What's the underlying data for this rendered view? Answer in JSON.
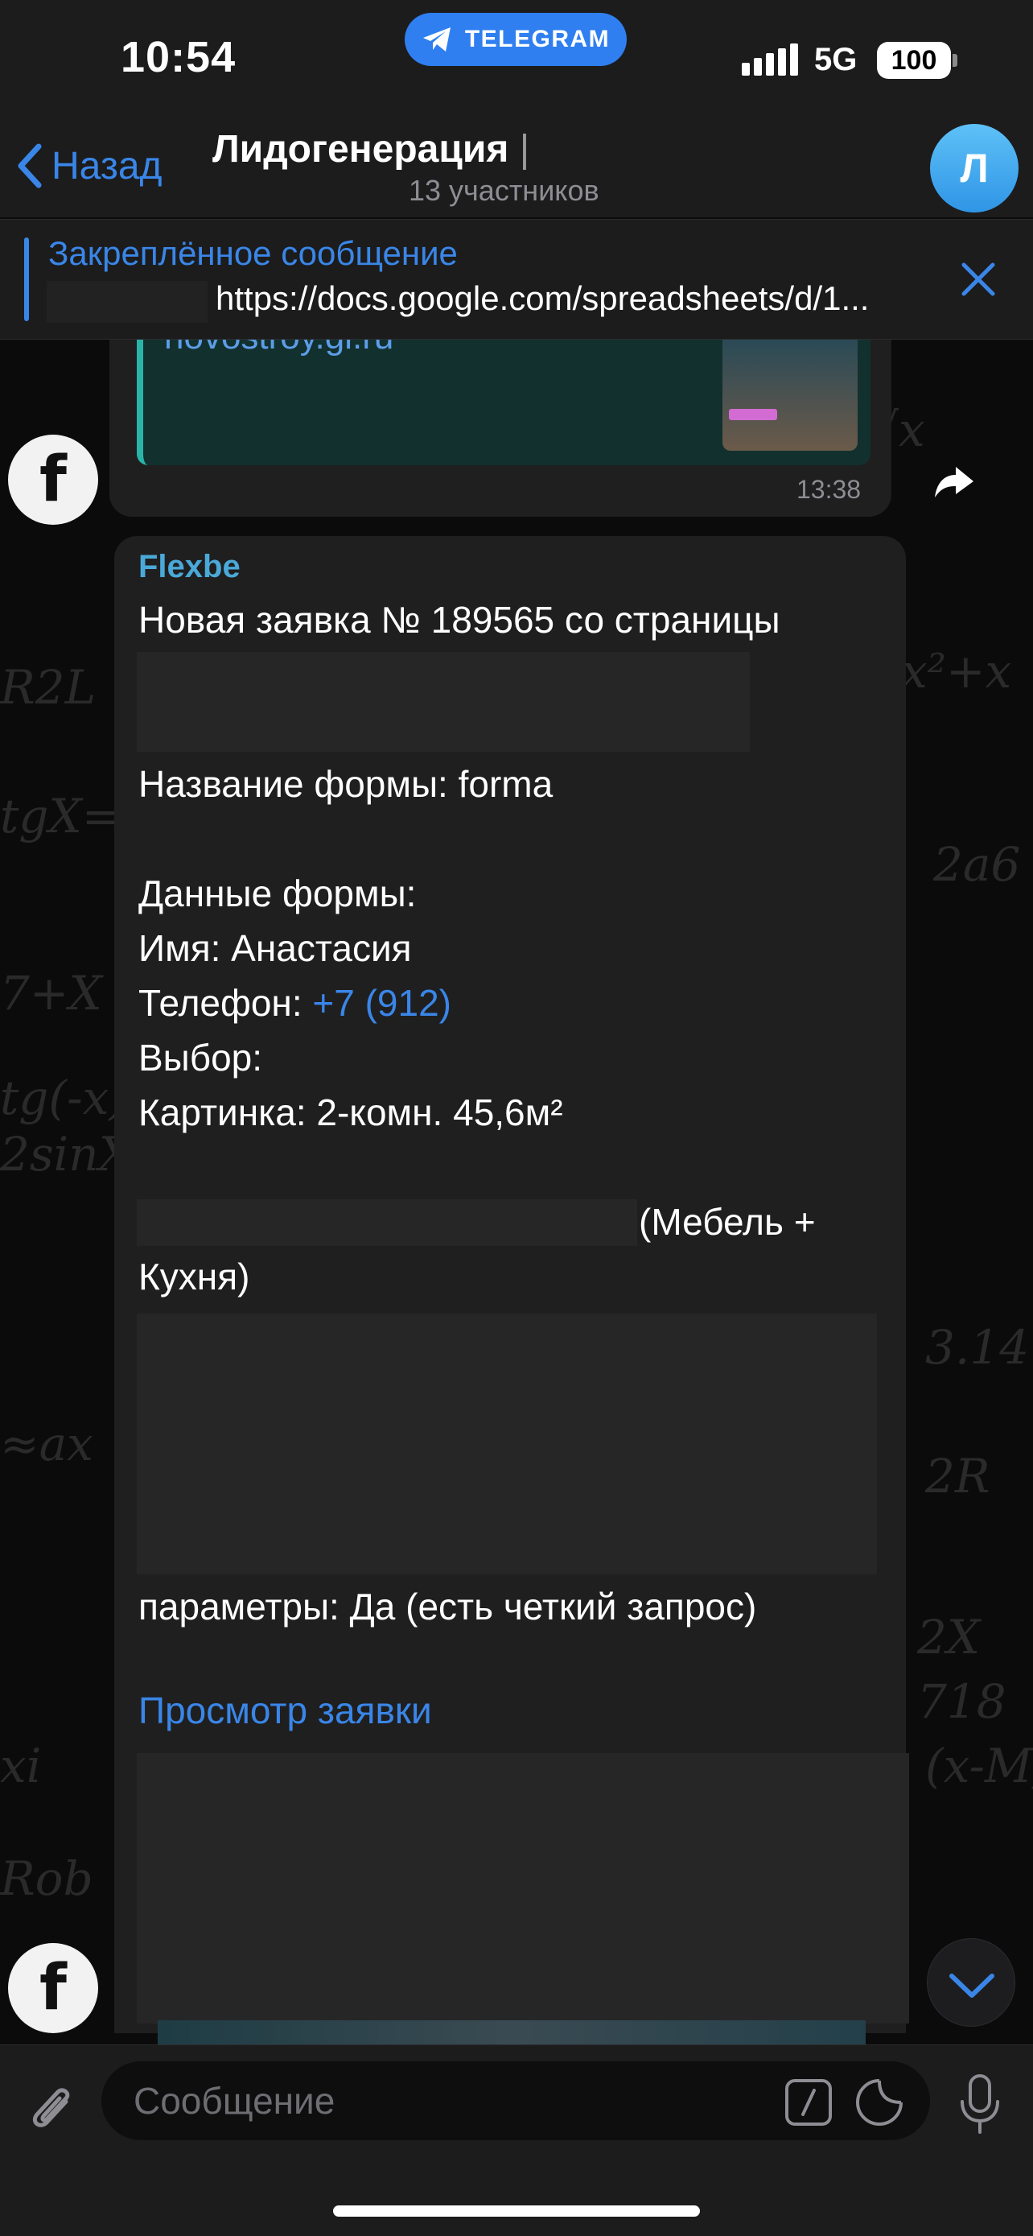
{
  "status_bar": {
    "time": "10:54",
    "app_pill": "TELEGRAM",
    "network": "5G",
    "battery": "100"
  },
  "header": {
    "back_label": "Назад",
    "title": "Лидогенерация",
    "subtitle": "13 участников",
    "avatar_letter": "Л"
  },
  "pinned": {
    "title": "Закреплённое сообщение",
    "text": "https://docs.google.com/spreadsheets/d/1..."
  },
  "previous_message": {
    "link_text": "novostroy.gi.ru",
    "time": "13:38"
  },
  "message": {
    "sender": "Flexbe",
    "line1": "Новая заявка № 189565 со страницы",
    "form_name": "Название формы: forma",
    "form_data_label": "Данные формы:",
    "name_line": "Имя: Анастасия",
    "phone_label": "Телефон: ",
    "phone_value": "+7 (912)",
    "choice_label": "Выбор:",
    "picture_line": "Картинка: 2-комн. 45,6м²",
    "furniture_tail": "(Мебель +",
    "furniture_line2": "Кухня)",
    "params_line": "параметры: Да (есть четкий запрос)",
    "view_link": "Просмотр заявки"
  },
  "input": {
    "placeholder": "Сообщение"
  },
  "colors": {
    "accent": "#3a86e8",
    "sender": "#4aa9d8",
    "bubble": "#1f1f20",
    "bar": "#1c1c1d"
  },
  "icons": [
    "telegram-plane-icon",
    "chevron-left-icon",
    "close-icon",
    "share-arrow-icon",
    "flexbe-favicon-icon",
    "chevron-down-icon",
    "paperclip-icon",
    "command-icon",
    "sticker-icon",
    "microphone-icon"
  ]
}
